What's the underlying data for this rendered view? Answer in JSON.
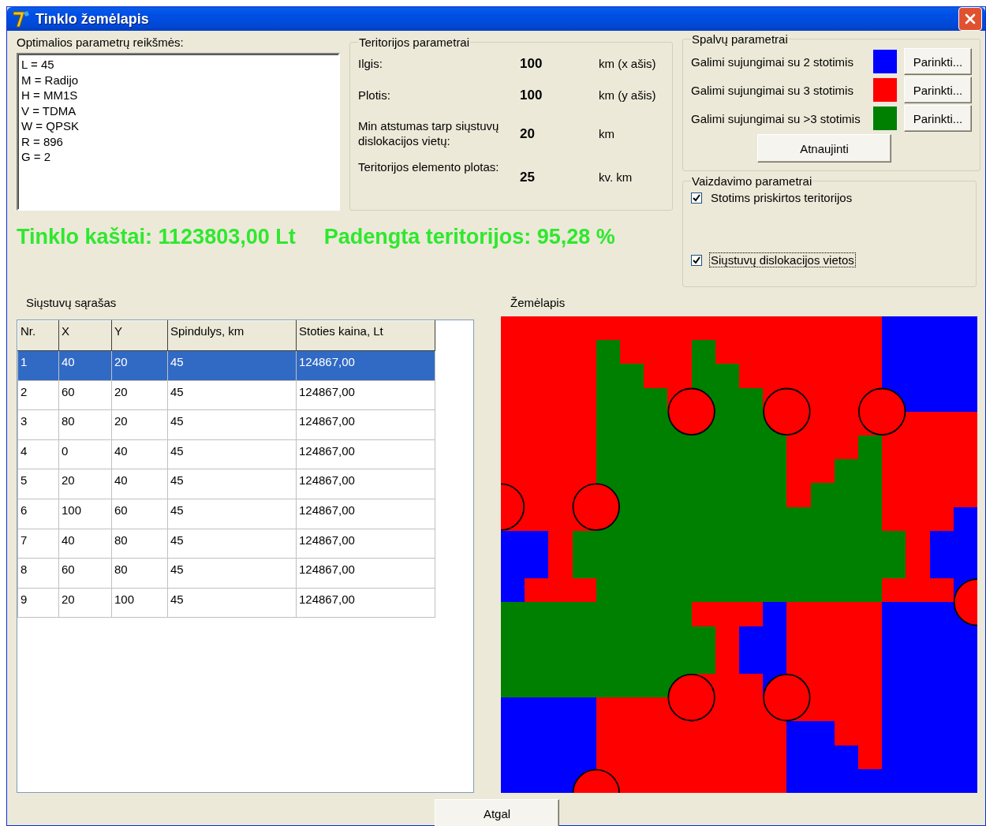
{
  "window": {
    "title": "Tinklo žemėlapis"
  },
  "optimal_params": {
    "label": "Optimalios parametrų reikšmės:",
    "lines": [
      "L = 45",
      "M = Radijo",
      "H = MM1S",
      "V = TDMA",
      "W = QPSK",
      "R = 896",
      "G = 2"
    ]
  },
  "territory": {
    "title": "Teritorijos parametrai",
    "rows": [
      {
        "label": "Ilgis:",
        "value": "100",
        "unit": "km (x ašis)"
      },
      {
        "label": "Plotis:",
        "value": "100",
        "unit": "km (y ašis)"
      },
      {
        "label": "Min atstumas tarp siųstuvų dislokacijos vietų:",
        "value": "20",
        "unit": "km"
      },
      {
        "label": "Teritorijos elemento plotas:",
        "value": "25",
        "unit": "kv. km"
      }
    ]
  },
  "colors": {
    "title": "Spalvų parametrai",
    "rows": [
      {
        "label": "Galimi sujungimai su 2 stotimis",
        "color": "#0000ff",
        "button": "Parinkti..."
      },
      {
        "label": "Galimi sujungimai su 3 stotimis",
        "color": "#ff0000",
        "button": "Parinkti..."
      },
      {
        "label": "Galimi sujungimai su >3 stotimis",
        "color": "#008000",
        "button": "Parinkti..."
      }
    ],
    "refresh_button": "Atnaujinti"
  },
  "display": {
    "title": "Vaizdavimo parametrai",
    "options": [
      {
        "label": "Stotims priskirtos teritorijos",
        "checked": true,
        "focused": false
      },
      {
        "label": "Siųstuvų dislokacijos vietos",
        "checked": true,
        "focused": true
      }
    ]
  },
  "summary": [
    "Tinklo kaštai: 1123803,00 Lt",
    "Padengta teritorijos: 95,28 %"
  ],
  "stations": {
    "label": "Siųstuvų sąrašas",
    "columns": [
      "Nr.",
      "X",
      "Y",
      "Spindulys, km",
      "Stoties kaina, Lt"
    ],
    "rows": [
      {
        "cells": [
          "1",
          "40",
          "20",
          "45",
          "124867,00"
        ],
        "selected": true
      },
      {
        "cells": [
          "2",
          "60",
          "20",
          "45",
          "124867,00"
        ],
        "selected": false
      },
      {
        "cells": [
          "3",
          "80",
          "20",
          "45",
          "124867,00"
        ],
        "selected": false
      },
      {
        "cells": [
          "4",
          "0",
          "40",
          "45",
          "124867,00"
        ],
        "selected": false
      },
      {
        "cells": [
          "5",
          "20",
          "40",
          "45",
          "124867,00"
        ],
        "selected": false
      },
      {
        "cells": [
          "6",
          "100",
          "60",
          "45",
          "124867,00"
        ],
        "selected": false
      },
      {
        "cells": [
          "7",
          "40",
          "80",
          "45",
          "124867,00"
        ],
        "selected": false
      },
      {
        "cells": [
          "8",
          "60",
          "80",
          "45",
          "124867,00"
        ],
        "selected": false
      },
      {
        "cells": [
          "9",
          "20",
          "100",
          "45",
          "124867,00"
        ],
        "selected": false
      }
    ]
  },
  "map": {
    "label": "Žemėlapis"
  },
  "back_button": "Atgal"
}
